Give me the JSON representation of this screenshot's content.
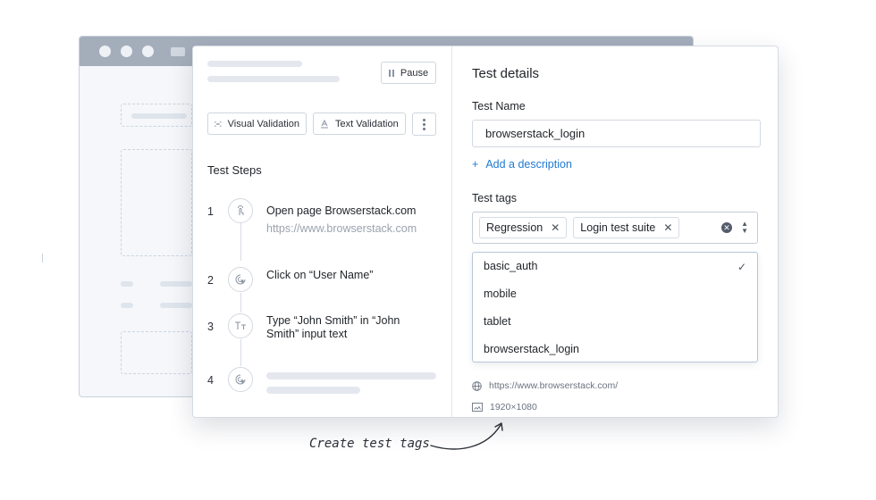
{
  "toolbar": {
    "pause_label": "Pause",
    "visual_validation_label": "Visual Validation",
    "text_validation_label": "Text Validation"
  },
  "steps": {
    "title": "Test Steps",
    "items": [
      {
        "number": "1",
        "text": "Open page Browserstack.com",
        "sub": "https://www.browserstack.com",
        "icon": "touch-icon"
      },
      {
        "number": "2",
        "text": "Click on “User Name”",
        "icon": "click-icon"
      },
      {
        "number": "3",
        "text_line1": "Type “John Smith” in “John",
        "text_line2": "Smith” input text",
        "icon": "text-type-icon"
      },
      {
        "number": "4",
        "icon": "click-icon"
      }
    ]
  },
  "details": {
    "heading": "Test details",
    "name_label": "Test Name",
    "name_value": "browserstack_login",
    "add_description": "Add a description",
    "tags_label": "Test tags",
    "selected_tags": [
      "Regression",
      "Login test suite"
    ],
    "tag_options": [
      {
        "label": "basic_auth",
        "checked": true
      },
      {
        "label": "mobile",
        "checked": false
      },
      {
        "label": "tablet",
        "checked": false
      },
      {
        "label": "browserstack_login",
        "checked": false
      }
    ],
    "url": "https://www.browserstack.com/",
    "resolution": "1920×1080"
  },
  "caption": "Create test tags",
  "colors": {
    "accent": "#1f7ad1",
    "titlebar": "#a4aebb"
  }
}
